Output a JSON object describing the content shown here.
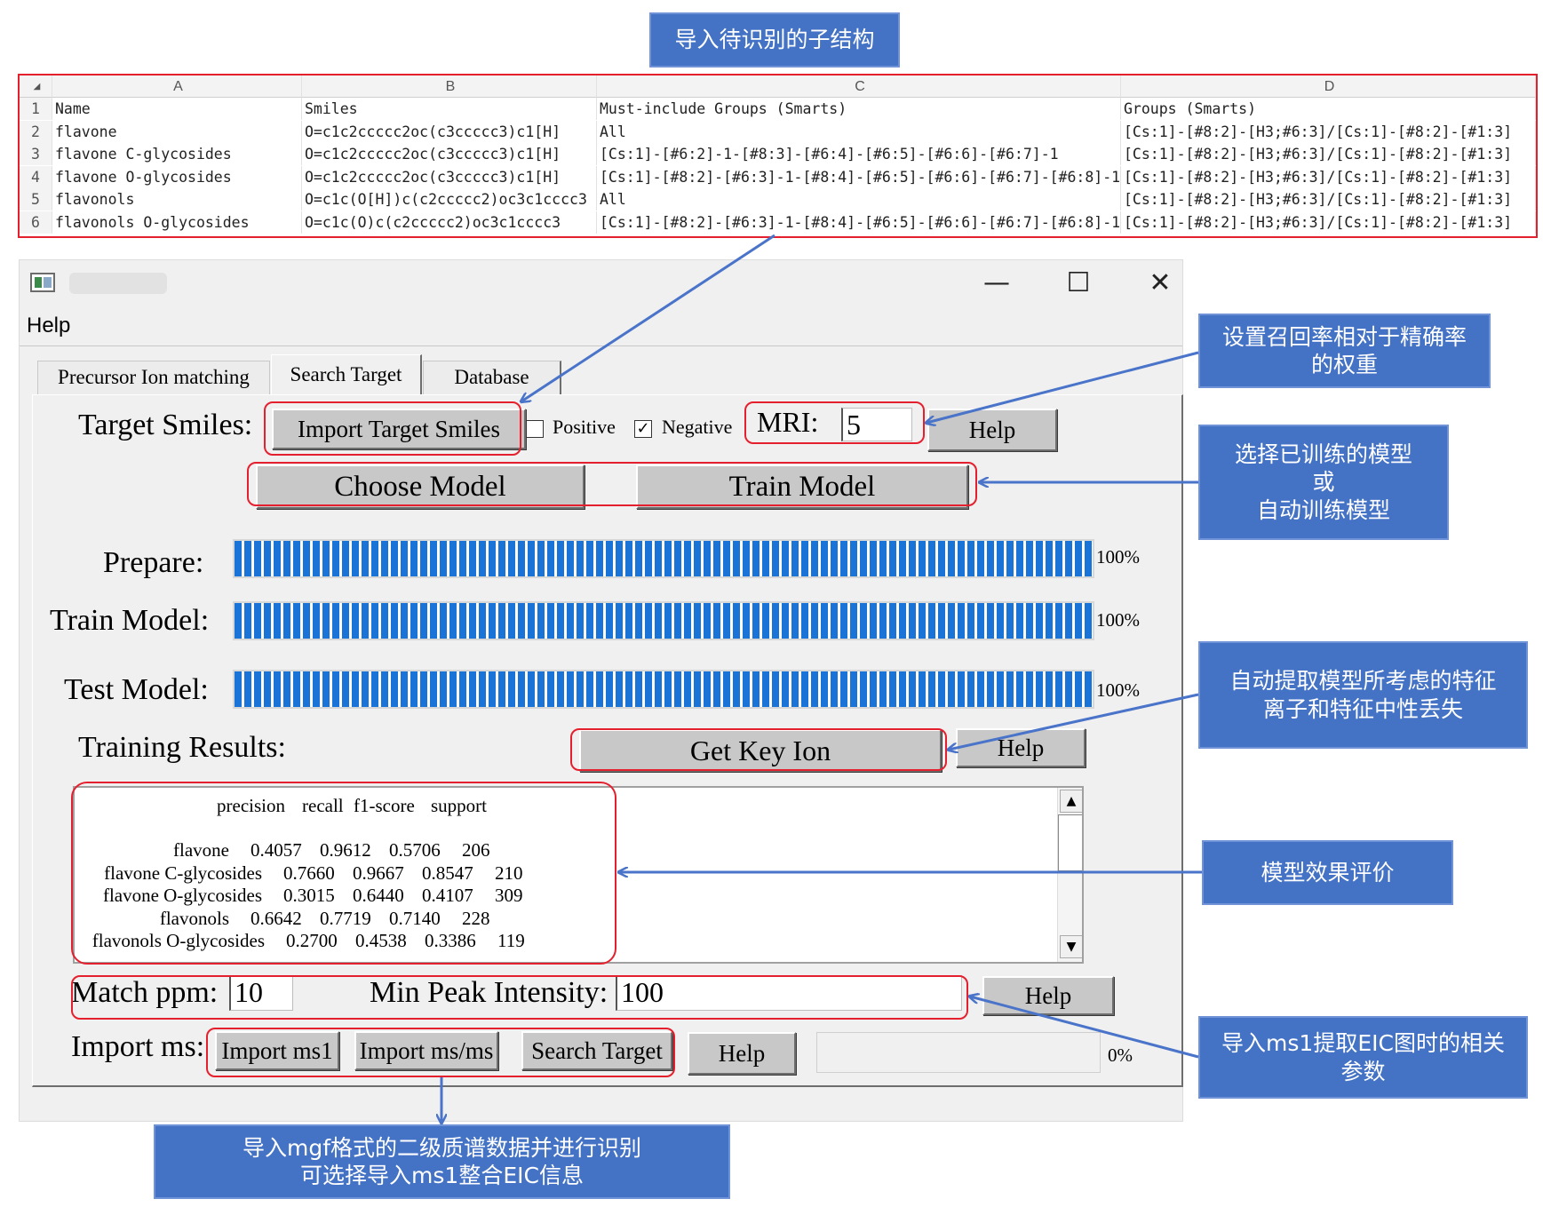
{
  "callouts": {
    "import_substructures": "导入待识别的子结构",
    "recall_weight": "设置召回率相对于精确率\n的权重",
    "choose_train_model": "选择已训练的模型\n或\n自动训练模型",
    "key_ion": "自动提取模型所考虑的特征\n离子和特征中性丢失",
    "model_eval": "模型效果评价",
    "eic_params": "导入ms1提取EIC图时的相关\n参数",
    "import_mgf": "导入mgf格式的二级质谱数据并进行识别\n可选择导入ms1整合EIC信息"
  },
  "spreadsheet": {
    "columns": [
      "A",
      "B",
      "C",
      "D"
    ],
    "rows": [
      {
        "num": "1",
        "cells": [
          "Name",
          "Smiles",
          "Must-include Groups (Smarts)",
          "Groups (Smarts)"
        ]
      },
      {
        "num": "2",
        "cells": [
          "flavone",
          "O=c1c2ccccc2oc(c3ccccc3)c1[H]",
          "All",
          "[Cs:1]-[#8:2]-[H3;#6:3]/[Cs:1]-[#8:2]-[#1:3]"
        ]
      },
      {
        "num": "3",
        "cells": [
          "flavone C-glycosides",
          "O=c1c2ccccc2oc(c3ccccc3)c1[H]",
          "[Cs:1]-[#6:2]-1-[#8:3]-[#6:4]-[#6:5]-[#6:6]-[#6:7]-1",
          "[Cs:1]-[#8:2]-[H3;#6:3]/[Cs:1]-[#8:2]-[#1:3]"
        ]
      },
      {
        "num": "4",
        "cells": [
          "flavone O-glycosides",
          "O=c1c2ccccc2oc(c3ccccc3)c1[H]",
          "[Cs:1]-[#8:2]-[#6:3]-1-[#8:4]-[#6:5]-[#6:6]-[#6:7]-[#6:8]-1",
          "[Cs:1]-[#8:2]-[H3;#6:3]/[Cs:1]-[#8:2]-[#1:3]"
        ]
      },
      {
        "num": "5",
        "cells": [
          "flavonols",
          "O=c1c(O[H])c(c2ccccc2)oc3c1cccc3",
          "All",
          "[Cs:1]-[#8:2]-[H3;#6:3]/[Cs:1]-[#8:2]-[#1:3]"
        ]
      },
      {
        "num": "6",
        "cells": [
          "flavonols O-glycosides",
          "O=c1c(O)c(c2ccccc2)oc3c1cccc3",
          "[Cs:1]-[#8:2]-[#6:3]-1-[#8:4]-[#6:5]-[#6:6]-[#6:7]-[#6:8]-1",
          "[Cs:1]-[#8:2]-[H3;#6:3]/[Cs:1]-[#8:2]-[#1:3]"
        ]
      }
    ]
  },
  "window": {
    "controls": {
      "minimize": "—",
      "maximize": "☐",
      "close": "✕"
    },
    "menu": {
      "help": "Help"
    },
    "tabs": [
      "Precursor Ion matching",
      "Search Target",
      "Database"
    ],
    "active_tab": "Search Target"
  },
  "form": {
    "target_smiles_label": "Target Smiles:",
    "import_target_smiles": "Import Target Smiles",
    "positive_label": "Positive",
    "positive_checked": false,
    "negative_label": "Negative",
    "negative_checked": true,
    "mri_label": "MRI:",
    "mri_value": "5",
    "help": "Help",
    "choose_model": "Choose Model",
    "train_model": "Train Model",
    "prepare_label": "Prepare:",
    "prepare_pct": "100%",
    "prepare_progress": 1.0,
    "train_label": "Train Model:",
    "train_pct": "100%",
    "train_progress": 1.0,
    "test_label": "Test Model:",
    "test_pct": "100%",
    "test_progress": 1.0,
    "training_results_label": "Training Results:",
    "get_key_ion": "Get Key Ion",
    "match_ppm_label": "Match ppm:",
    "match_ppm_value": "10",
    "min_peak_label": "Min Peak Intensity:",
    "min_peak_value": "100",
    "import_ms_label": "Import ms:",
    "import_ms1": "Import ms1",
    "import_msms": "Import ms/ms",
    "search_target": "Search Target",
    "search_pct": "0%",
    "search_progress": 0.0
  },
  "results": {
    "header": [
      "precision",
      "recall",
      "f1-score",
      "support"
    ],
    "rows": [
      {
        "name": "flavone",
        "precision": "0.4057",
        "recall": "0.9612",
        "f1": "0.5706",
        "support": "206"
      },
      {
        "name": "flavone C-glycosides",
        "precision": "0.7660",
        "recall": "0.9667",
        "f1": "0.8547",
        "support": "210"
      },
      {
        "name": "flavone O-glycosides",
        "precision": "0.3015",
        "recall": "0.6440",
        "f1": "0.4107",
        "support": "309"
      },
      {
        "name": "flavonols",
        "precision": "0.6642",
        "recall": "0.7719",
        "f1": "0.7140",
        "support": "228"
      },
      {
        "name": "flavonols O-glycosides",
        "precision": "0.2700",
        "recall": "0.4538",
        "f1": "0.3386",
        "support": "119"
      }
    ]
  },
  "colors": {
    "callout": "#4472c4",
    "highlight": "#e5202e",
    "progress": "#1a74d8",
    "arrow": "#4a74c9"
  }
}
